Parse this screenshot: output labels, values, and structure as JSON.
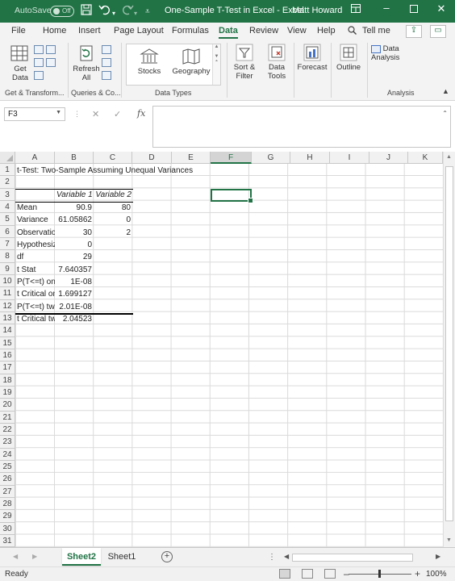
{
  "titlebar": {
    "autosave_label": "AutoSave",
    "autosave_state": "Off",
    "document_title": "One-Sample T-Test in Excel  -  Excel",
    "user_name": "Matt Howard",
    "icons": [
      "save-icon",
      "undo-icon",
      "redo-icon",
      "customize-qat-icon",
      "ribbon-display-icon",
      "minimize-icon",
      "maximize-icon",
      "close-icon"
    ]
  },
  "ribbon_tabs": {
    "tabs": [
      "File",
      "Home",
      "Insert",
      "Page Layout",
      "Formulas",
      "Data",
      "Review",
      "View",
      "Help"
    ],
    "active": "Data",
    "tell_me": "Tell me"
  },
  "ribbon": {
    "get_data": "Get Data",
    "refresh_all": "Refresh All",
    "stocks": "Stocks",
    "geography": "Geography",
    "sort_filter": "Sort & Filter",
    "data_tools": "Data Tools",
    "forecast": "Forecast",
    "outline": "Outline",
    "data_analysis": "Data Analysis",
    "groups": {
      "get_transform": "Get & Transform...",
      "queries": "Queries & Co...",
      "data_types": "Data Types",
      "analysis": "Analysis"
    }
  },
  "formula_bar": {
    "name_box": "F3",
    "fx_label": "fx",
    "formula": ""
  },
  "grid": {
    "columns": [
      "A",
      "B",
      "C",
      "D",
      "E",
      "F",
      "G",
      "H",
      "I",
      "J",
      "K"
    ],
    "selected_column": "F",
    "rows": [
      "1",
      "2",
      "3",
      "4",
      "5",
      "6",
      "7",
      "8",
      "9",
      "10",
      "11",
      "12",
      "13",
      "14",
      "15",
      "16",
      "17",
      "18",
      "19",
      "20",
      "21",
      "22",
      "23",
      "24",
      "25",
      "26",
      "27",
      "28",
      "29",
      "30",
      "31"
    ],
    "title": "t-Test: Two-Sample Assuming Unequal Variances",
    "header_b": "Variable 1",
    "header_c": "Variable 2",
    "table": [
      {
        "label": "Mean",
        "v1": "90.9",
        "v2": "80"
      },
      {
        "label": "Variance",
        "v1": "61.05862",
        "v2": "0"
      },
      {
        "label": "Observations",
        "v1": "30",
        "v2": "2"
      },
      {
        "label": "Hypothesized Mean Difference",
        "v1": "0",
        "v2": ""
      },
      {
        "label": "df",
        "v1": "29",
        "v2": ""
      },
      {
        "label": "t Stat",
        "v1": "7.640357",
        "v2": ""
      },
      {
        "label": "P(T<=t) one-tail",
        "v1": "1E-08",
        "v2": ""
      },
      {
        "label": "t Critical one-tail",
        "v1": "1.699127",
        "v2": ""
      },
      {
        "label": "P(T<=t) two-tail",
        "v1": "2.01E-08",
        "v2": ""
      },
      {
        "label": "t Critical two-tail",
        "v1": "2.04523",
        "v2": ""
      }
    ],
    "active_cell": "F3"
  },
  "sheets": {
    "tabs": [
      "Sheet2",
      "Sheet1"
    ],
    "active": "Sheet2"
  },
  "status": {
    "ready": "Ready",
    "zoom": "100%"
  },
  "colors": {
    "brand": "#217346",
    "ribbon_bg": "#f3f3f3"
  }
}
